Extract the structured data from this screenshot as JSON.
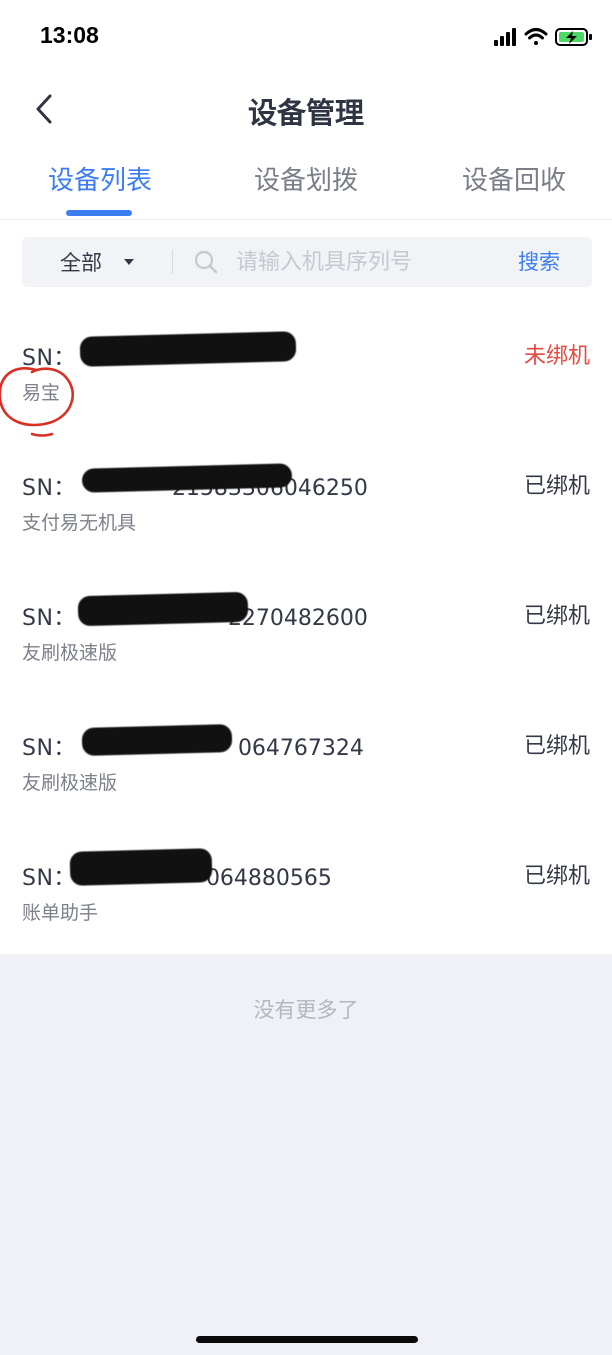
{
  "status_bar": {
    "time": "13:08",
    "icons": [
      "signal-icon",
      "wifi-icon",
      "battery-charging-icon"
    ],
    "battery_color": "#4CD964"
  },
  "header": {
    "title": "设备管理",
    "back_icon": "chevron-left-icon"
  },
  "tabs": [
    {
      "label": "设备列表",
      "active": true
    },
    {
      "label": "设备划拨",
      "active": false
    },
    {
      "label": "设备回收",
      "active": false
    }
  ],
  "search": {
    "filter_value": "全部",
    "placeholder": "请输入机具序列号",
    "value": "",
    "button_label": "搜索"
  },
  "sn_prefix": "SN：",
  "devices": [
    {
      "sn_visible": "",
      "type": "易宝",
      "status": "未绑机"
    },
    {
      "sn_visible": "21583306046250",
      "type": "支付易无机具",
      "status": "已绑机"
    },
    {
      "sn_visible": "2270482600",
      "type": "友刷极速版",
      "status": "已绑机"
    },
    {
      "sn_visible": "064767324",
      "type": "友刷极速版",
      "status": "已绑机"
    },
    {
      "sn_visible": "064880565",
      "type": "账单助手",
      "status": "已绑机"
    }
  ],
  "list_end_text": "没有更多了",
  "colors": {
    "accent": "#3D7DF2",
    "unbound": "#E8483D",
    "annotation": "#D93025",
    "background": "#F0F1F6"
  }
}
